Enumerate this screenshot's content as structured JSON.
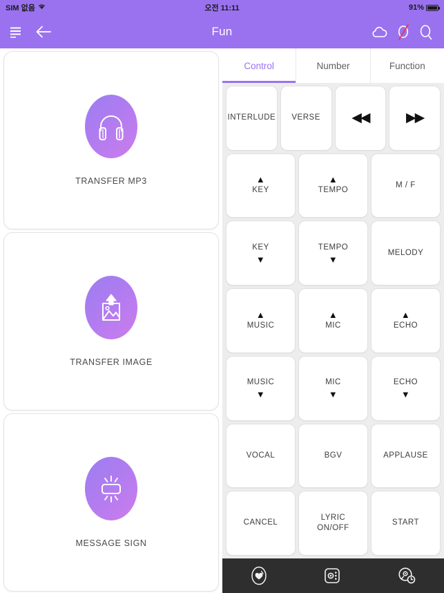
{
  "statusbar": {
    "carrier": "SIM 없음",
    "wifi_icon": "wifi-icon",
    "time": "오전 11:11",
    "battery_percent": "91%",
    "battery_icon": "battery-icon"
  },
  "navbar": {
    "menu_icon": "hamburger-menu-icon",
    "back_icon": "back-arrow-icon",
    "title": "Fun",
    "cloud_icon": "cloud-icon",
    "mute_icon": "mute-slash-icon",
    "search_icon": "search-icon"
  },
  "left_panel": {
    "cards": [
      {
        "label": "TRANSFER MP3",
        "icon": "headphones-icon"
      },
      {
        "label": "TRANSFER IMAGE",
        "icon": "image-upload-icon"
      },
      {
        "label": "MESSAGE SIGN",
        "icon": "message-sign-icon"
      }
    ]
  },
  "tabs": [
    {
      "label": "Control",
      "active": true
    },
    {
      "label": "Number",
      "active": false
    },
    {
      "label": "Function",
      "active": false
    }
  ],
  "control_grid": {
    "rows": [
      [
        {
          "text": "INTERLUDE",
          "arrow": "",
          "glyph": ""
        },
        {
          "text": "VERSE",
          "arrow": "",
          "glyph": ""
        },
        {
          "text": "",
          "arrow": "",
          "glyph": "◀◀"
        },
        {
          "text": "",
          "arrow": "",
          "glyph": "▶▶"
        }
      ],
      [
        {
          "text": "KEY",
          "arrow": "▲",
          "arrow_pos": "top",
          "glyph": ""
        },
        {
          "text": "TEMPO",
          "arrow": "▲",
          "arrow_pos": "top",
          "glyph": ""
        },
        {
          "text": "M / F",
          "arrow": "",
          "glyph": ""
        }
      ],
      [
        {
          "text": "KEY",
          "arrow": "▼",
          "arrow_pos": "bottom",
          "glyph": ""
        },
        {
          "text": "TEMPO",
          "arrow": "▼",
          "arrow_pos": "bottom",
          "glyph": ""
        },
        {
          "text": "MELODY",
          "arrow": "",
          "glyph": ""
        }
      ],
      [
        {
          "text": "MUSIC",
          "arrow": "▲",
          "arrow_pos": "top",
          "glyph": ""
        },
        {
          "text": "MIC",
          "arrow": "▲",
          "arrow_pos": "top",
          "glyph": ""
        },
        {
          "text": "ECHO",
          "arrow": "▲",
          "arrow_pos": "top",
          "glyph": ""
        }
      ],
      [
        {
          "text": "MUSIC",
          "arrow": "▼",
          "arrow_pos": "bottom",
          "glyph": ""
        },
        {
          "text": "MIC",
          "arrow": "▼",
          "arrow_pos": "bottom",
          "glyph": ""
        },
        {
          "text": "ECHO",
          "arrow": "▼",
          "arrow_pos": "bottom",
          "glyph": ""
        }
      ],
      [
        {
          "text": "VOCAL",
          "arrow": "",
          "glyph": ""
        },
        {
          "text": "BGV",
          "arrow": "",
          "glyph": ""
        },
        {
          "text": "APPLAUSE",
          "arrow": "",
          "glyph": ""
        }
      ],
      [
        {
          "text": "CANCEL",
          "arrow": "",
          "glyph": ""
        },
        {
          "text": "LYRIC\nON/OFF",
          "arrow": "",
          "glyph": ""
        },
        {
          "text": "START",
          "arrow": "",
          "glyph": ""
        }
      ]
    ]
  },
  "bottombar": {
    "items": [
      {
        "icon": "heart-circle-icon"
      },
      {
        "icon": "equalizer-settings-icon"
      },
      {
        "icon": "disc-history-icon"
      }
    ]
  },
  "colors": {
    "brand_purple": "#9a72ef",
    "panel_gray": "#ededed",
    "bottom_dark": "#2e2e2e",
    "gradient_start": "#9b7ef0",
    "gradient_end": "#cc7ced",
    "mute_red": "#e23b4e"
  }
}
